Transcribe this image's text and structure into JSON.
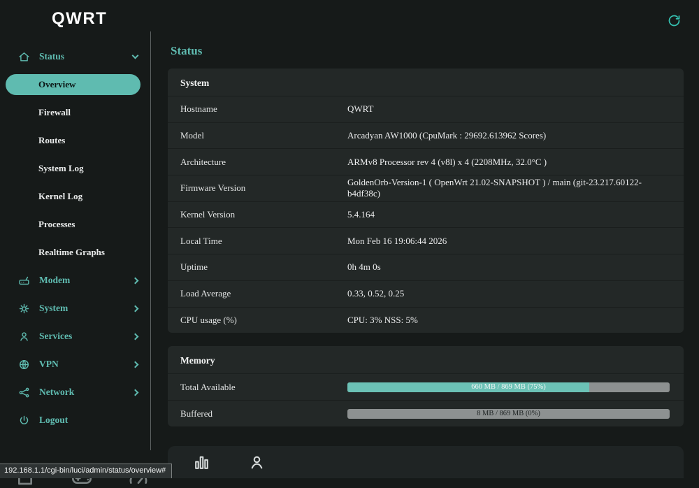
{
  "logo": "QWRT",
  "page": {
    "title": "Status"
  },
  "sidebar": {
    "items": [
      {
        "label": "Status",
        "icon": "home-icon",
        "expanded": true,
        "children": [
          "Overview",
          "Firewall",
          "Routes",
          "System Log",
          "Kernel Log",
          "Processes",
          "Realtime Graphs"
        ],
        "active_child": "Overview"
      },
      {
        "label": "Modem",
        "icon": "modem-icon"
      },
      {
        "label": "System",
        "icon": "gear-icon"
      },
      {
        "label": "Services",
        "icon": "user-icon"
      },
      {
        "label": "VPN",
        "icon": "globe-icon"
      },
      {
        "label": "Network",
        "icon": "network-icon"
      },
      {
        "label": "Logout",
        "icon": "power-icon"
      }
    ]
  },
  "system_card": {
    "title": "System",
    "rows": [
      {
        "label": "Hostname",
        "value": "QWRT"
      },
      {
        "label": "Model",
        "value": "Arcadyan AW1000 (CpuMark : 29692.613962 Scores)"
      },
      {
        "label": "Architecture",
        "value": "ARMv8 Processor rev 4 (v8l) x 4 (2208MHz, 32.0°C )"
      },
      {
        "label": "Firmware Version",
        "value": "GoldenOrb-Version-1 ( OpenWrt 21.02-SNAPSHOT ) / main (git-23.217.60122-b4df38c)"
      },
      {
        "label": "Kernel Version",
        "value": "5.4.164"
      },
      {
        "label": "Local Time",
        "value": "Mon Feb 16 19:06:44 2026"
      },
      {
        "label": "Uptime",
        "value": "0h 4m 0s"
      },
      {
        "label": "Load Average",
        "value": "0.33, 0.52, 0.25"
      },
      {
        "label": "CPU usage (%)",
        "value": "CPU: 3% NSS: 5%"
      }
    ]
  },
  "memory_card": {
    "title": "Memory",
    "rows": [
      {
        "label": "Total Available",
        "text": "660 MB / 869 MB (75%)",
        "percent": 75
      },
      {
        "label": "Buffered",
        "text": "8 MB / 869 MB (0%)",
        "percent": 0
      }
    ]
  },
  "statusbar": {
    "url": "192.168.1.1/cgi-bin/luci/admin/status/overview#"
  },
  "colors": {
    "accent": "#5fbbb0",
    "page_bg": "#161a19",
    "card_bg": "#232827",
    "bar_track": "#8d9191",
    "bar_fill": "#6cc2b6"
  }
}
